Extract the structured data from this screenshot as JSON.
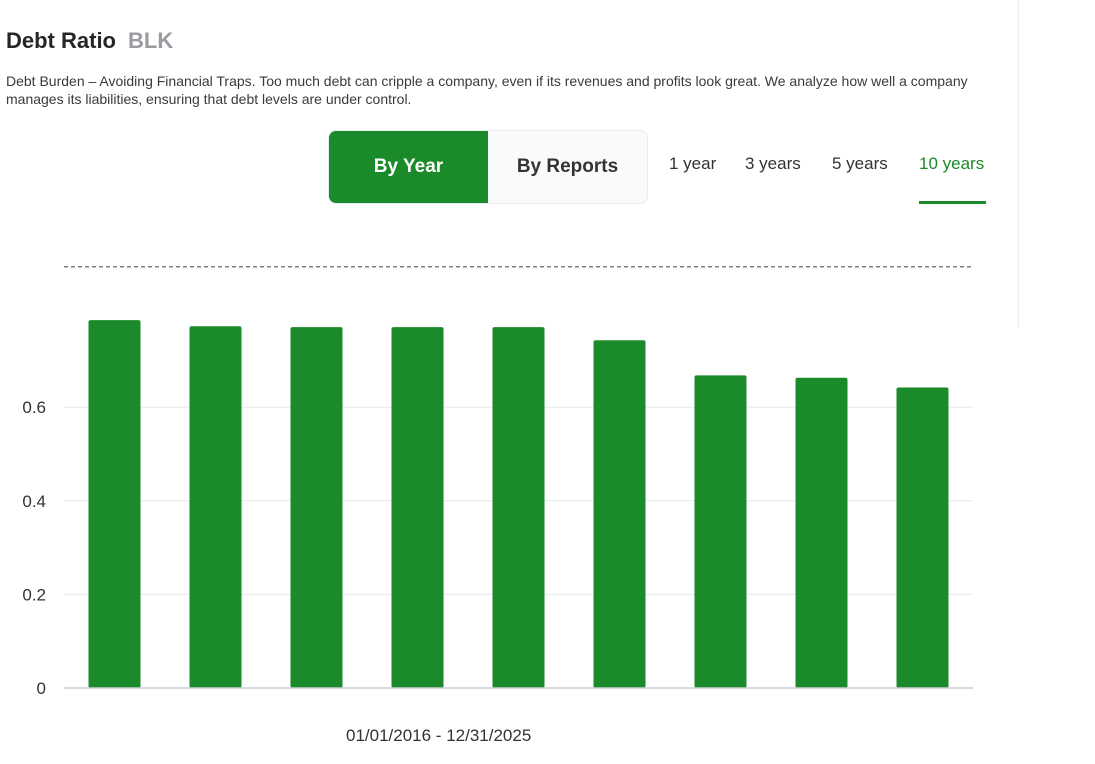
{
  "header": {
    "title": "Debt Ratio",
    "ticker": "BLK"
  },
  "description": "Debt Burden – Avoiding Financial Traps. Too much debt can cripple a company, even if its revenues and profits look great. We analyze how well a company manages its liabilities, ensuring that debt levels are under control.",
  "view_toggle": {
    "by_year": "By Year",
    "by_reports": "By Reports",
    "selected": "By Year"
  },
  "periods": [
    "1 year",
    "3 years",
    "5 years",
    "10 years"
  ],
  "selected_period": "10 years",
  "date_range": "01/01/2016 - 12/31/2025",
  "colors": {
    "accent": "#1b8a2a",
    "bar": "#1b8a2a",
    "danger_line": "#e87a93",
    "reference_line": "#555555",
    "grid": "#e6e9ec"
  },
  "chart_data": {
    "type": "bar",
    "title": "",
    "xlabel": "",
    "ylabel": "",
    "ylim": [
      0,
      1
    ],
    "yticks": [
      0,
      0.2,
      0.4,
      0.6,
      1
    ],
    "grid": true,
    "reference_lines": [
      {
        "value": 1,
        "style": "dashed",
        "color": "#e87a93"
      },
      {
        "value": 0.9,
        "style": "dashed",
        "color": "#555555"
      }
    ],
    "values": [
      0.786,
      0.773,
      0.771,
      0.771,
      0.771,
      0.743,
      0.668,
      0.663,
      0.642
    ]
  }
}
